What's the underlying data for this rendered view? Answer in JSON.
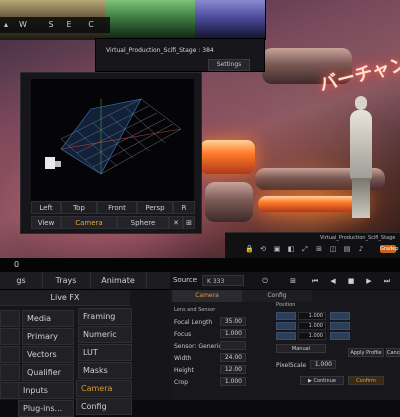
{
  "toolbar": {
    "buttons": [
      "W",
      "S",
      "E",
      "C"
    ]
  },
  "stage": {
    "title": "Virtual_Production_Scifi_Stage : 384",
    "settings_label": "Settings"
  },
  "viewport": {
    "views": [
      "Left",
      "Top",
      "Front",
      "Persp",
      "R"
    ],
    "modes": [
      "View",
      "Camera",
      "Sphere",
      "✕",
      "⊞"
    ],
    "active_mode": "Camera"
  },
  "scene": {
    "neon_sign": "バーチャント"
  },
  "monitor_bar": {
    "subtitle": "Virtual_Production_Scifi_Stage",
    "badge": "Gradep"
  },
  "timeline": {
    "frame": "0"
  },
  "tabs": [
    "gs",
    "Trays",
    "Animate"
  ],
  "transport": {
    "source_label": "Source",
    "source_value": "K  333"
  },
  "left_menu": {
    "header": "Live FX",
    "col1": [
      "",
      "",
      "",
      "",
      "",
      ""
    ],
    "col2": [
      "Media",
      "Primary",
      "Vectors",
      "Qualifier",
      "Inputs",
      "Plug-ins..."
    ],
    "col3": [
      "Framing",
      "Numeric",
      "LUT",
      "Masks",
      "Camera",
      "Config"
    ],
    "active": "Camera"
  },
  "props": {
    "tabs": [
      "Camera",
      "Config"
    ],
    "section_lens": "Lens and Sensor",
    "section_position": "Position",
    "fields": [
      {
        "label": "Focal Length",
        "value": "35.00"
      },
      {
        "label": "Focus",
        "value": "1.000"
      },
      {
        "label": "Sensor: Generic",
        "value": ""
      },
      {
        "label": "Width",
        "value": "24.00"
      },
      {
        "label": "Height",
        "value": "12.00"
      },
      {
        "label": "Crop",
        "value": "1.000"
      }
    ],
    "mini_values": [
      "1.000",
      "1.000",
      "1.000"
    ],
    "manual_label": "Manual",
    "pixel_scale_label": "PixelScale",
    "pixel_scale_value": "1.000",
    "apply_label": "Apply Profile",
    "cancel_label": "Cancel",
    "continue_label": "▶ Continue",
    "ok_label": "Confirm"
  }
}
